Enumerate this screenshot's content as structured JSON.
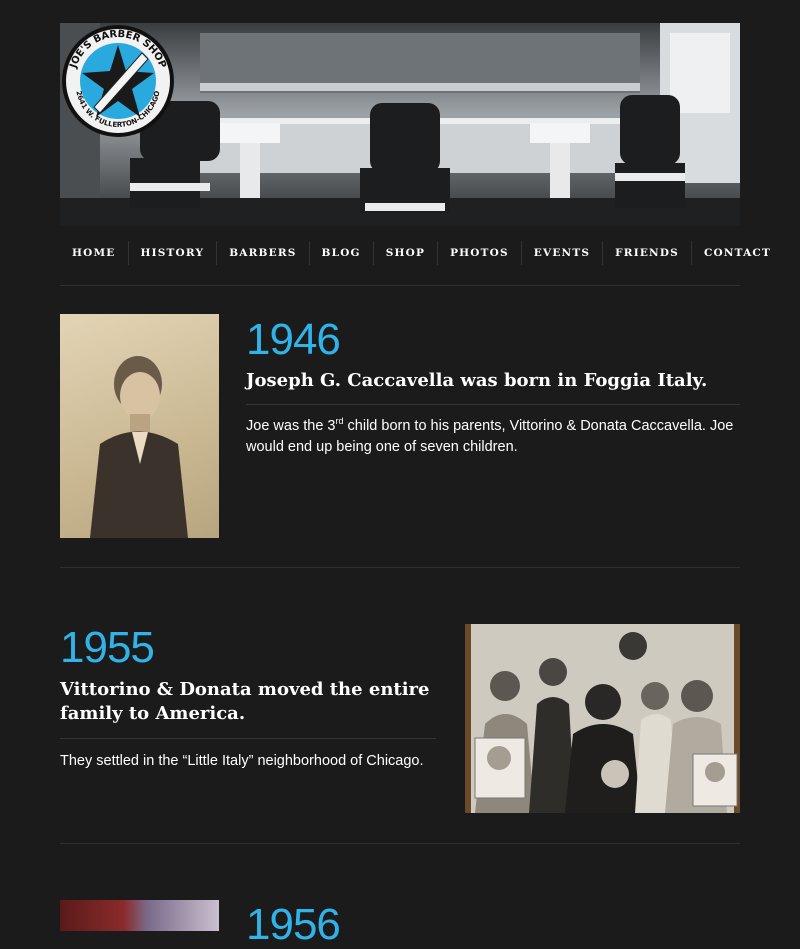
{
  "brand": {
    "logo_text_top": "JOE'S BARBER SHOP",
    "logo_text_bottom": "2641 W. FULLERTON-CHICAGO"
  },
  "nav": [
    "HOME",
    "HISTORY",
    "BARBERS",
    "BLOG",
    "SHOP",
    "PHOTOS",
    "EVENTS",
    "FRIENDS",
    "CONTACT"
  ],
  "entries": [
    {
      "year": "1946",
      "headline": "Joseph G. Caccavella was born in Foggia Italy.",
      "body_pre": "Joe was the 3",
      "body_sup": "rd",
      "body_post": " child born to his parents, Vittorino & Donata Caccavella. Joe would end up being one of seven children."
    },
    {
      "year": "1955",
      "headline": "Vittorino & Donata moved the entire family to America.",
      "body": "They settled in the “Little Italy” neighborhood of Chicago."
    },
    {
      "year": "1956"
    }
  ],
  "colors": {
    "background": "#1b1b1c",
    "accent": "#2fb3e8",
    "logo_blue": "#29a9de"
  }
}
